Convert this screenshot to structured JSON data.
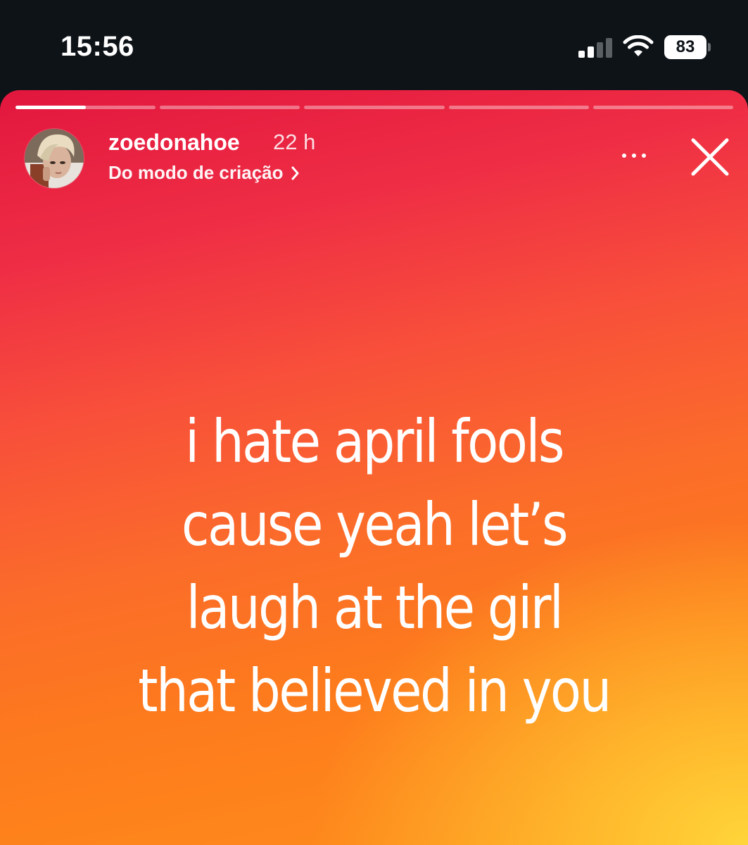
{
  "status_bar": {
    "time": "15:56",
    "battery": "83",
    "battery_level": 0.83,
    "signal_bars_active": 2,
    "signal_bars_total": 4
  },
  "story": {
    "segments_total": 5,
    "current_segment_progress": 0.5,
    "username": "zoedonahoe",
    "time_ago": "22 h",
    "source_label": "Do modo de criação",
    "text_lines": [
      "i hate april fools",
      "cause yeah let’s",
      "laugh at the girl",
      "that believed in you"
    ],
    "colors": {
      "gradient_top": "#e2163e",
      "gradient_mid": "#fb6c2a",
      "gradient_corner": "#ffd53a"
    },
    "icons": {
      "more": "more-options-icon",
      "close": "close-icon",
      "chevron": "chevron-right-icon"
    }
  }
}
